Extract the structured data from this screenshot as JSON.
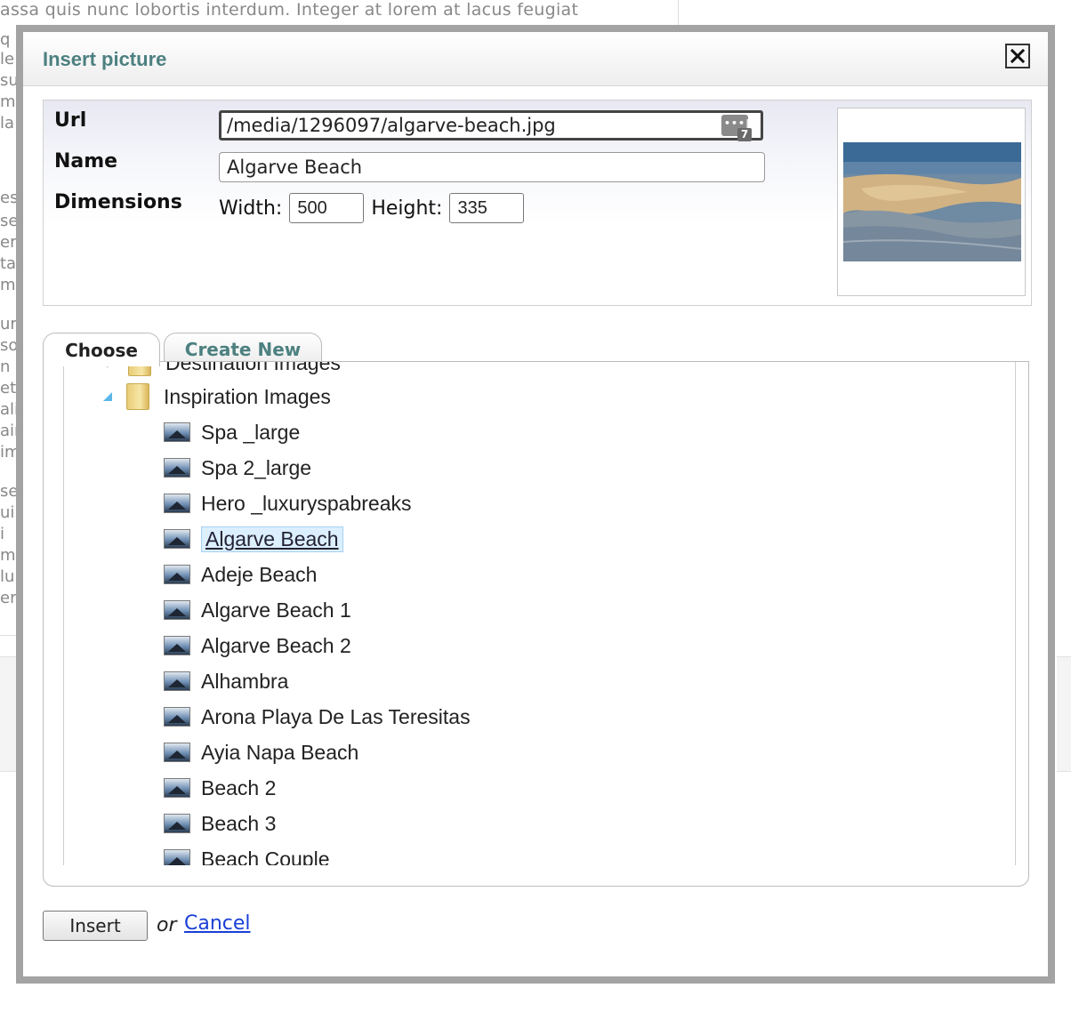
{
  "background": {
    "top_line": "assa quis nunc lobortis interdum. Integer at lorem at lacus feugiat",
    "fragments": [
      "q",
      "le",
      "su",
      "m",
      "la",
      "es",
      "se",
      "er",
      "ta",
      "me",
      "ur",
      "so",
      "n",
      "et",
      "ali",
      "ain",
      "im",
      "se",
      "ui",
      "i",
      "m",
      "lu",
      "er"
    ]
  },
  "dialog": {
    "title": "Insert picture",
    "close_label": "×"
  },
  "properties": {
    "url_label": "Url",
    "url_value": "/media/1296097/algarve-beach.jpg",
    "url_icon_badge": "7",
    "name_label": "Name",
    "name_value": "Algarve Beach",
    "dimensions_label": "Dimensions",
    "width_label": "Width:",
    "width_value": "500",
    "height_label": "Height:",
    "height_value": "335"
  },
  "tabs": {
    "choose": "Choose",
    "create_new": "Create New"
  },
  "tree": {
    "partial_folder": "Destination Images",
    "folder": "Inspiration Images",
    "items": [
      "Spa _large",
      "Spa 2_large",
      "Hero _luxuryspabreaks",
      "Algarve Beach",
      "Adeje Beach",
      "Algarve Beach 1",
      "Algarve Beach 2",
      "Alhambra",
      "Arona Playa De Las Teresitas",
      "Ayia Napa Beach",
      "Beach 2",
      "Beach 3",
      "Beach Couple"
    ],
    "selected_item": "Algarve Beach"
  },
  "footer": {
    "insert_label": "Insert",
    "or_text": "or",
    "cancel_label": "Cancel"
  },
  "colors": {
    "title": "#4d8080",
    "dialog_border": "#a3a3a3",
    "link": "#1a3fd6",
    "selection": "#dcefff"
  }
}
